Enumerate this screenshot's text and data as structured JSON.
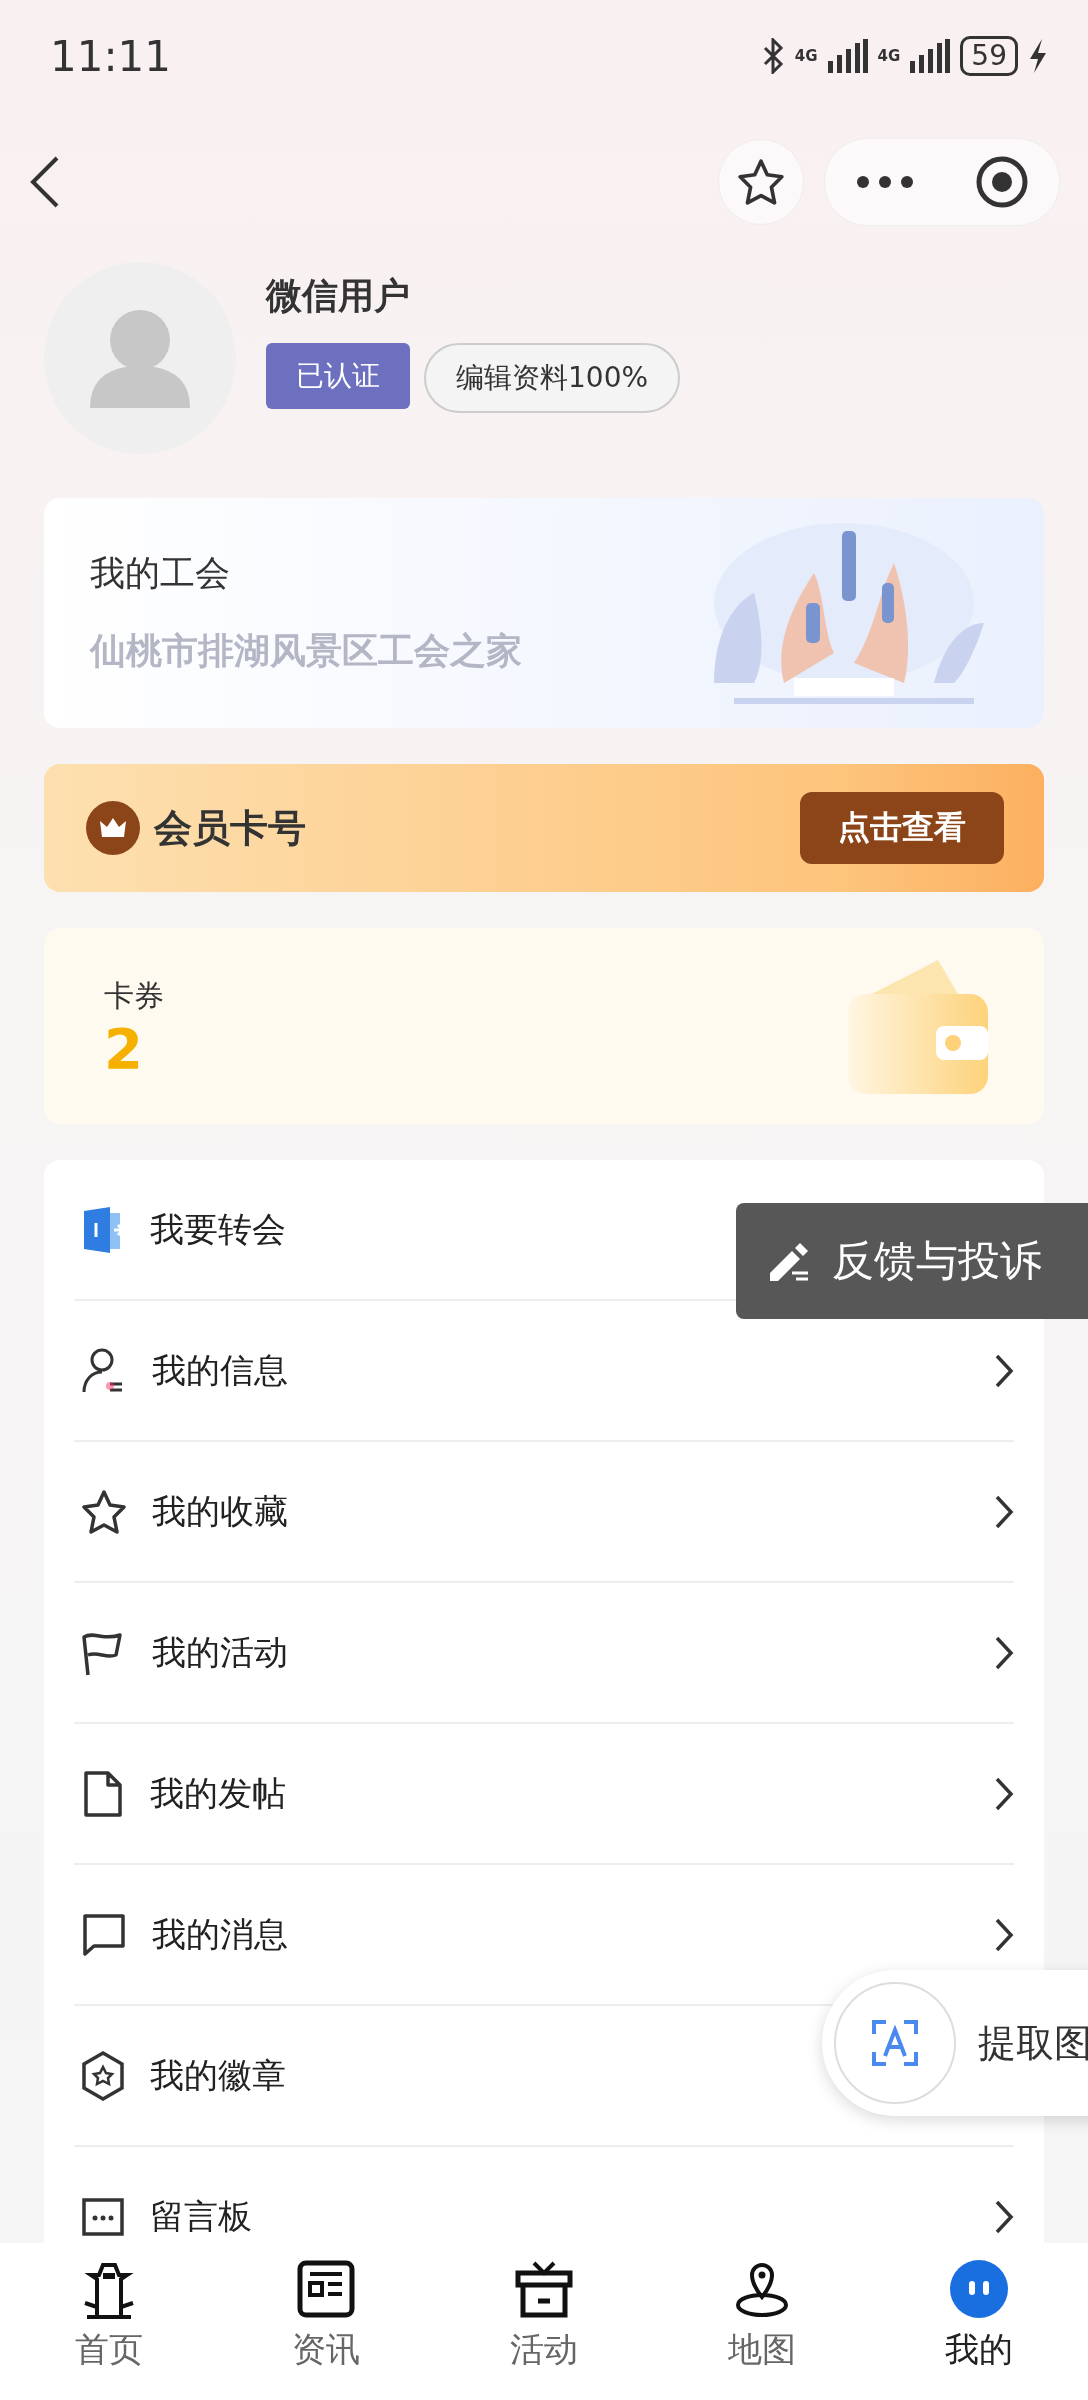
{
  "status_bar": {
    "time": "11:11",
    "networks": [
      "4G",
      "4G"
    ],
    "battery": "59"
  },
  "profile": {
    "name": "微信用户",
    "verified": "已认证",
    "edit": "编辑资料100%"
  },
  "union_card": {
    "title": "我的工会",
    "name": "仙桃市排湖风景区工会之家"
  },
  "member_card": {
    "title": "会员卡号",
    "button": "点击查看"
  },
  "coupon_card": {
    "label": "卡券",
    "count": "2"
  },
  "menu": [
    {
      "label": "我要转会"
    },
    {
      "label": "我的信息"
    },
    {
      "label": "我的收藏"
    },
    {
      "label": "我的活动"
    },
    {
      "label": "我的发帖"
    },
    {
      "label": "我的消息"
    },
    {
      "label": "我的徽章"
    },
    {
      "label": "留言板"
    }
  ],
  "feedback_button": "反馈与投诉",
  "ocr_bubble": "提取图",
  "tab_bar": [
    {
      "label": "首页",
      "selected": false
    },
    {
      "label": "资讯",
      "selected": false
    },
    {
      "label": "活动",
      "selected": false
    },
    {
      "label": "地图",
      "selected": false
    },
    {
      "label": "我的",
      "selected": true
    }
  ]
}
